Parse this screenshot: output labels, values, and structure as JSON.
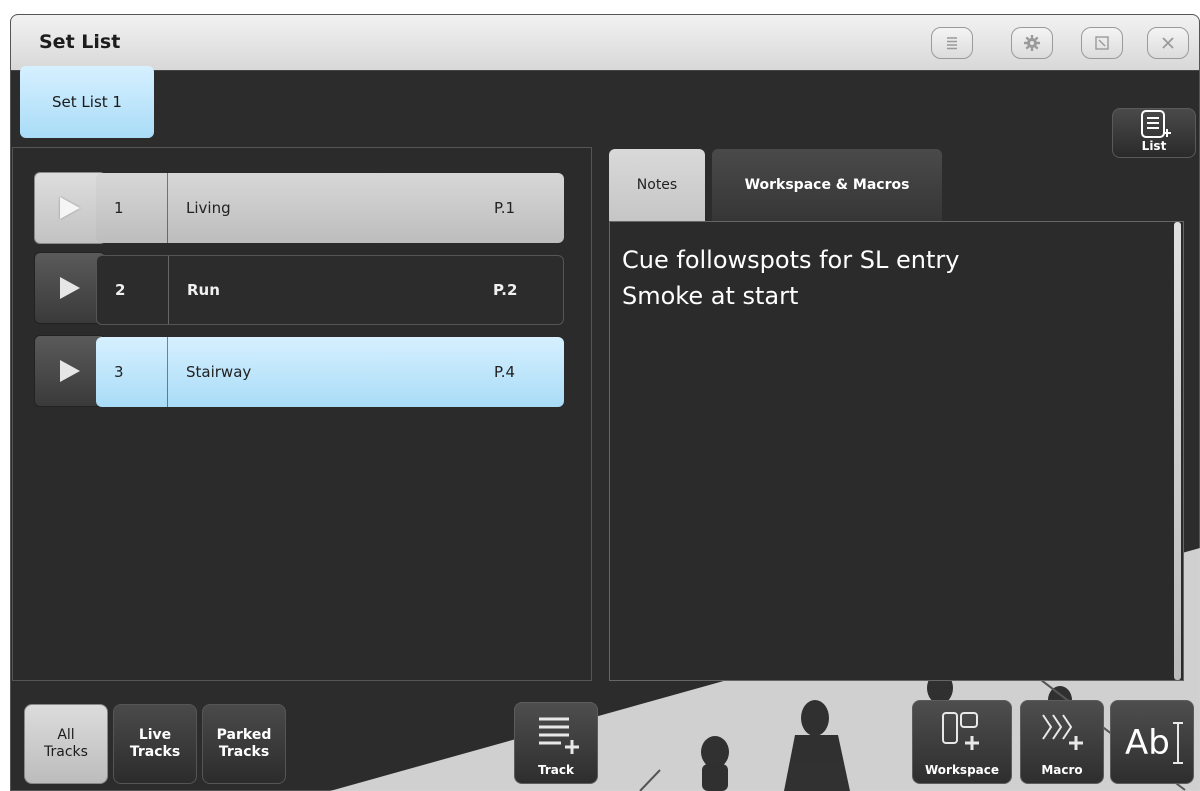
{
  "window": {
    "title": "Set List",
    "titlebar_buttons": [
      "menu-icon",
      "gear-icon",
      "restore-icon",
      "close-icon"
    ]
  },
  "set_list_tab": {
    "label": "Set List 1"
  },
  "list_button": {
    "label": "List",
    "icon": "list-add-icon"
  },
  "rows": [
    {
      "number": "1",
      "name": "Living",
      "page": "P.1",
      "state": "played"
    },
    {
      "number": "2",
      "name": "Run",
      "page": "P.2",
      "state": "normal"
    },
    {
      "number": "3",
      "name": "Stairway",
      "page": "P.4",
      "state": "selected"
    }
  ],
  "tabs": {
    "notes": "Notes",
    "workspace_macros": "Workspace & Macros"
  },
  "notes": {
    "line1": "Cue followspots for SL entry",
    "line2": "Smoke at start"
  },
  "bottom_left": {
    "all_tracks_l1": "All",
    "all_tracks_l2": "Tracks",
    "live_tracks_l1": "Live",
    "live_tracks_l2": "Tracks",
    "parked_tracks_l1": "Parked",
    "parked_tracks_l2": "Tracks",
    "track": "Track"
  },
  "bottom_right": {
    "workspace": "Workspace",
    "macro": "Macro",
    "text": "Ab"
  },
  "colors": {
    "accent_blue": "#a9dcf7",
    "panel_bg": "#2c2c2c",
    "played_gray": "#c8c8c8"
  }
}
